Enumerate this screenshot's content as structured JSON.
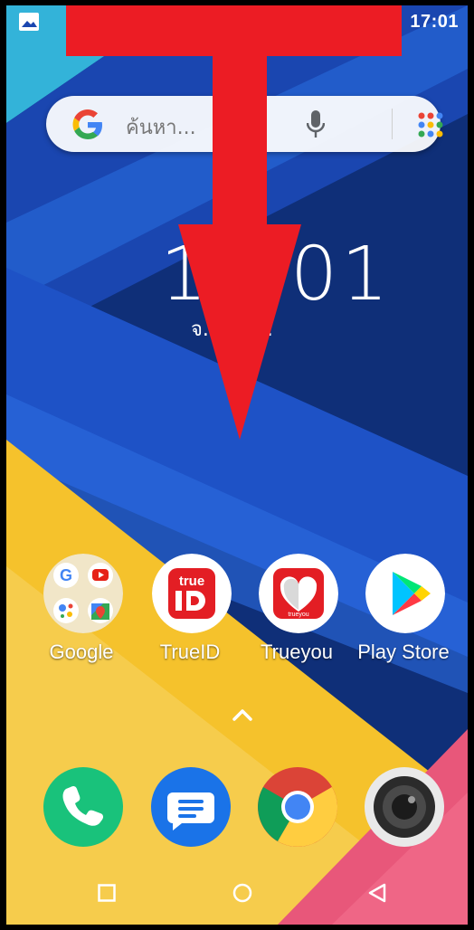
{
  "status_bar": {
    "time": "17:01"
  },
  "search": {
    "placeholder": "ค้นหา..."
  },
  "clock_widget": {
    "time": "17:01",
    "date": "จ. 1 ต.ค."
  },
  "apps": [
    {
      "label": "Google",
      "icon": "google-folder-icon"
    },
    {
      "label": "TrueID",
      "icon": "trueid-icon"
    },
    {
      "label": "Trueyou",
      "icon": "trueyou-icon"
    },
    {
      "label": "Play Store",
      "icon": "play-store-icon"
    }
  ],
  "dock": [
    {
      "icon": "phone-icon"
    },
    {
      "icon": "messages-icon"
    },
    {
      "icon": "chrome-icon"
    },
    {
      "icon": "camera-icon"
    }
  ],
  "nav_bar": {
    "recents": "recents-icon",
    "home": "home-icon",
    "back": "back-icon"
  },
  "colors": {
    "arrow": "#ec1c24",
    "accent_yellow": "#f5c22c",
    "wallpaper_blue": "#1f56c4"
  }
}
